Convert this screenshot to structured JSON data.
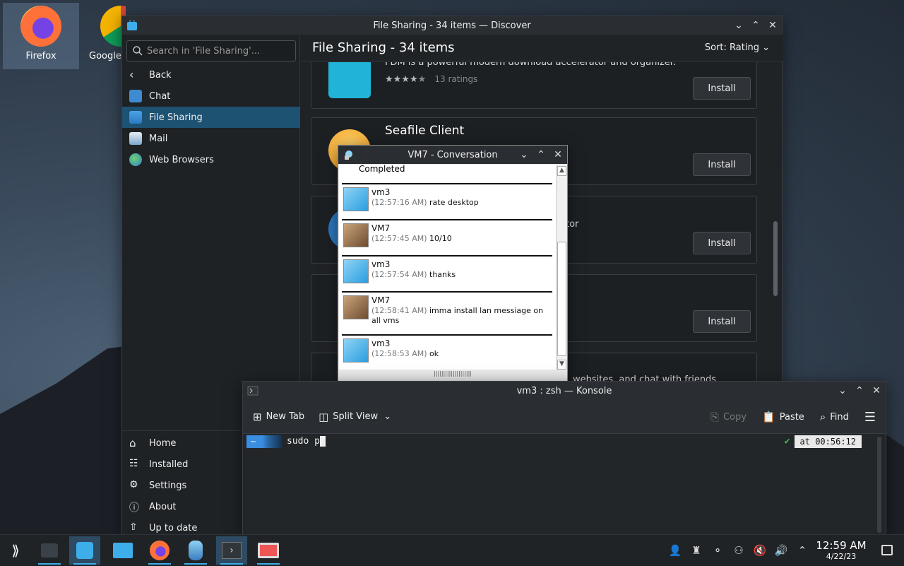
{
  "desktop": {
    "icons": [
      {
        "label": "Firefox"
      },
      {
        "label": "Google"
      }
    ]
  },
  "discover": {
    "title": "File Sharing - 34 items — Discover",
    "search_placeholder": "Search in 'File Sharing'...",
    "back_label": "Back",
    "categories": [
      {
        "label": "Chat"
      },
      {
        "label": "File Sharing"
      },
      {
        "label": "Mail"
      },
      {
        "label": "Web Browsers"
      }
    ],
    "bottom_nav": [
      {
        "label": "Home"
      },
      {
        "label": "Installed"
      },
      {
        "label": "Settings"
      },
      {
        "label": "About"
      },
      {
        "label": "Up to date"
      }
    ],
    "header": "File Sharing - 34 items",
    "sort_label": "Sort: Rating",
    "cards": [
      {
        "name": "",
        "desc": "FDM is a powerful modern download accelerator and organizer.",
        "ratings": "13 ratings",
        "install": "Install"
      },
      {
        "name": "Seafile Client",
        "desc": "",
        "install": "Install"
      },
      {
        "name": "",
        "desc": "tor",
        "install": "Install"
      },
      {
        "name": "",
        "desc": "",
        "install": "Install"
      },
      {
        "name": "",
        "desc": "websites, and chat with friends",
        "install": ""
      }
    ]
  },
  "conversation": {
    "title": "VM7 - Conversation",
    "top_status": "Completed",
    "messages": [
      {
        "sender": "vm3",
        "time": "(12:57:16 AM)",
        "text": "rate desktop"
      },
      {
        "sender": "VM7",
        "time": "(12:57:45 AM)",
        "text": "10/10"
      },
      {
        "sender": "vm3",
        "time": "(12:57:54 AM)",
        "text": "thanks"
      },
      {
        "sender": "VM7",
        "time": "(12:58:41 AM)",
        "text": "imma install lan messiage on all vms"
      },
      {
        "sender": "vm3",
        "time": "(12:58:53 AM)",
        "text": "ok"
      }
    ]
  },
  "konsole": {
    "title": "vm3 : zsh — Konsole",
    "new_tab": "New Tab",
    "split_view": "Split View",
    "copy": "Copy",
    "paste": "Paste",
    "find": "Find",
    "prompt_dir": "~",
    "command": "sudo p",
    "time_label": "at 00:56:12"
  },
  "taskbar": {
    "time": "12:59 AM",
    "date": "4/22/23"
  }
}
